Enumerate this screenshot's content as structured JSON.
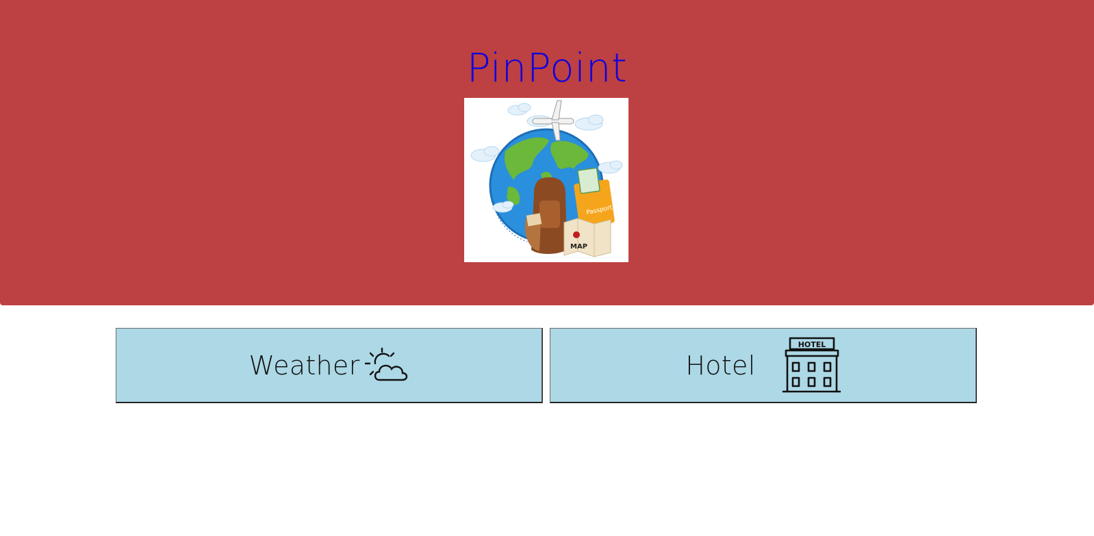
{
  "colors": {
    "header_bg": "#bd4142",
    "title": "#1100dd",
    "button_bg": "#add8e6"
  },
  "header": {
    "title": "PinPoint",
    "hero_image": "travel-globe-illustration",
    "hero_map_label": "MAP",
    "hero_passport_label": "Passport"
  },
  "nav": {
    "weather": {
      "label": "Weather",
      "icon": "partly-cloudy-icon"
    },
    "hotel": {
      "label": "Hotel",
      "icon": "hotel-building-icon",
      "sign": "HOTEL"
    }
  }
}
